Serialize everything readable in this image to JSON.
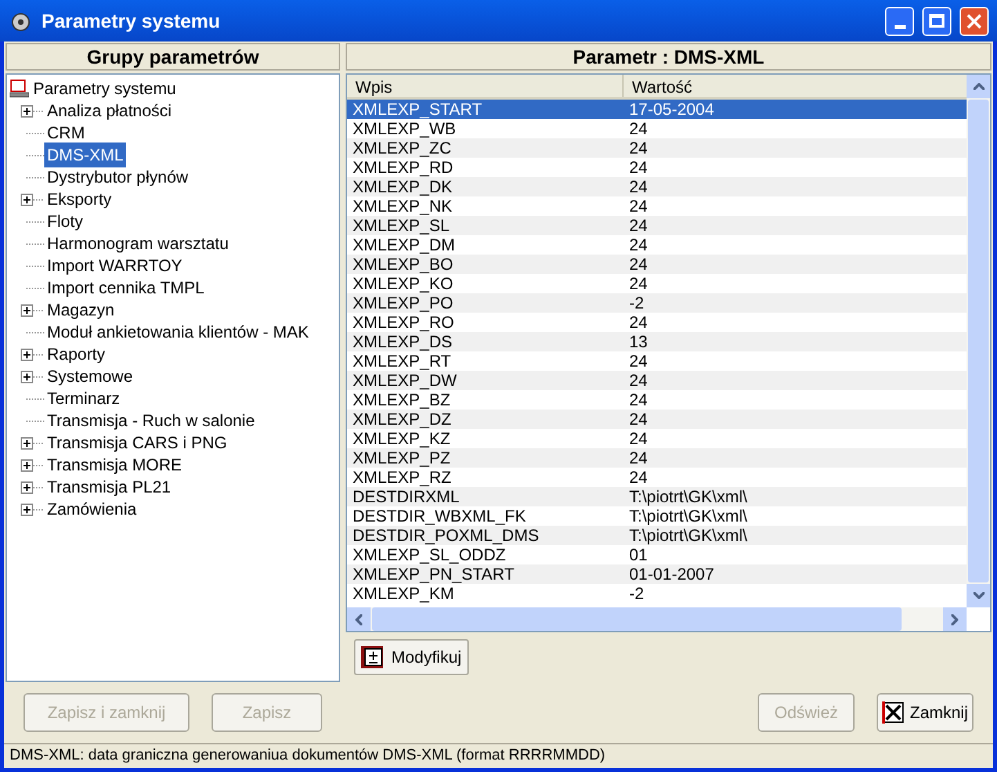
{
  "window": {
    "title": "Parametry systemu"
  },
  "groups_panel": {
    "header": "Grupy parametrów",
    "root": "Parametry systemu",
    "items": [
      {
        "label": "Analiza płatności",
        "expandable": true,
        "selected": false
      },
      {
        "label": "CRM",
        "expandable": false,
        "selected": false
      },
      {
        "label": "DMS-XML",
        "expandable": false,
        "selected": true
      },
      {
        "label": "Dystrybutor płynów",
        "expandable": false,
        "selected": false
      },
      {
        "label": "Eksporty",
        "expandable": true,
        "selected": false
      },
      {
        "label": "Floty",
        "expandable": false,
        "selected": false
      },
      {
        "label": "Harmonogram warsztatu",
        "expandable": false,
        "selected": false
      },
      {
        "label": "Import WARRTOY",
        "expandable": false,
        "selected": false
      },
      {
        "label": "Import cennika TMPL",
        "expandable": false,
        "selected": false
      },
      {
        "label": "Magazyn",
        "expandable": true,
        "selected": false
      },
      {
        "label": "Moduł ankietowania klientów - MAK",
        "expandable": false,
        "selected": false
      },
      {
        "label": "Raporty",
        "expandable": true,
        "selected": false
      },
      {
        "label": "Systemowe",
        "expandable": true,
        "selected": false
      },
      {
        "label": "Terminarz",
        "expandable": false,
        "selected": false
      },
      {
        "label": "Transmisja - Ruch w salonie",
        "expandable": false,
        "selected": false
      },
      {
        "label": "Transmisja CARS i PNG",
        "expandable": true,
        "selected": false
      },
      {
        "label": "Transmisja MORE",
        "expandable": true,
        "selected": false
      },
      {
        "label": "Transmisja PL21",
        "expandable": true,
        "selected": false
      },
      {
        "label": "Zamówienia",
        "expandable": true,
        "selected": false
      }
    ]
  },
  "params_panel": {
    "header": "Parametr : DMS-XML",
    "columns": [
      "Wpis",
      "Wartość"
    ],
    "rows": [
      {
        "entry": "XMLEXP_START",
        "value": "17-05-2004",
        "selected": true
      },
      {
        "entry": "XMLEXP_WB",
        "value": "24",
        "selected": false
      },
      {
        "entry": "XMLEXP_ZC",
        "value": "24",
        "selected": false
      },
      {
        "entry": "XMLEXP_RD",
        "value": "24",
        "selected": false
      },
      {
        "entry": "XMLEXP_DK",
        "value": "24",
        "selected": false
      },
      {
        "entry": "XMLEXP_NK",
        "value": "24",
        "selected": false
      },
      {
        "entry": "XMLEXP_SL",
        "value": "24",
        "selected": false
      },
      {
        "entry": "XMLEXP_DM",
        "value": "24",
        "selected": false
      },
      {
        "entry": "XMLEXP_BO",
        "value": "24",
        "selected": false
      },
      {
        "entry": "XMLEXP_KO",
        "value": "24",
        "selected": false
      },
      {
        "entry": "XMLEXP_PO",
        "value": "-2",
        "selected": false
      },
      {
        "entry": "XMLEXP_RO",
        "value": "24",
        "selected": false
      },
      {
        "entry": "XMLEXP_DS",
        "value": "13",
        "selected": false
      },
      {
        "entry": "XMLEXP_RT",
        "value": "24",
        "selected": false
      },
      {
        "entry": "XMLEXP_DW",
        "value": "24",
        "selected": false
      },
      {
        "entry": "XMLEXP_BZ",
        "value": "24",
        "selected": false
      },
      {
        "entry": "XMLEXP_DZ",
        "value": "24",
        "selected": false
      },
      {
        "entry": "XMLEXP_KZ",
        "value": "24",
        "selected": false
      },
      {
        "entry": "XMLEXP_PZ",
        "value": "24",
        "selected": false
      },
      {
        "entry": "XMLEXP_RZ",
        "value": "24",
        "selected": false
      },
      {
        "entry": "DESTDIRXML",
        "value": "T:\\piotrt\\GK\\xml\\",
        "selected": false
      },
      {
        "entry": "DESTDIR_WBXML_FK",
        "value": "T:\\piotrt\\GK\\xml\\",
        "selected": false
      },
      {
        "entry": "DESTDIR_POXML_DMS",
        "value": "T:\\piotrt\\GK\\xml\\",
        "selected": false
      },
      {
        "entry": "XMLEXP_SL_ODDZ",
        "value": "01",
        "selected": false
      },
      {
        "entry": "XMLEXP_PN_START",
        "value": "01-01-2007",
        "selected": false
      },
      {
        "entry": "XMLEXP_KM",
        "value": "-2",
        "selected": false
      }
    ],
    "modify_button": "Modyfikuj"
  },
  "buttons_left": [
    {
      "label": "Zapisz i zamknij",
      "disabled": true
    },
    {
      "label": "Zapisz",
      "disabled": true
    }
  ],
  "buttons_right": [
    {
      "label": "Odśwież",
      "disabled": true,
      "kind": "plain"
    },
    {
      "label": "Zamknij",
      "disabled": false,
      "kind": "close"
    }
  ],
  "status_bar": "DMS-XML: data graniczna generowaniua dokumentów DMS-XML (format RRRRMMDD)"
}
